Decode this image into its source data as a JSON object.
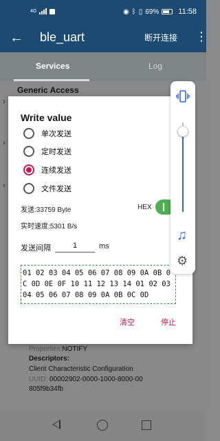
{
  "status_bar": {
    "network": "4G",
    "battery": "69%",
    "time": "11:58"
  },
  "app_bar": {
    "title": "ble_uart",
    "disconnect_label": "断开连接"
  },
  "tabs": [
    {
      "label": "Services",
      "active": true
    },
    {
      "label": "Log",
      "active": false
    }
  ],
  "background": {
    "service_title": "Generic Access",
    "properties_label": "Properties:",
    "properties_value": "NOTIFY",
    "descriptors_label": "Descriptors:",
    "descriptor_name": "Client Characteristic Configuration",
    "uuid_label": "UUID:",
    "uuid_value": "00002902-0000-1000-8000-00",
    "uuid_value_2": "805f9b34fb"
  },
  "dialog": {
    "title": "Write value",
    "options": [
      {
        "label": "单次发送",
        "checked": false
      },
      {
        "label": "定时发送",
        "checked": false
      },
      {
        "label": "连续发送",
        "checked": true
      },
      {
        "label": "文件发送",
        "checked": false
      }
    ],
    "sent_text": "发送:33759 Byte",
    "hex_label": "HEX",
    "hex_enabled": true,
    "speed_text": "实时速度:5301 B/s",
    "interval_label": "发送间隔",
    "interval_value": "1",
    "interval_unit": "ms",
    "data": "01 02 03 04 05 06 07 08 09 0A 0B 0C 0D 0E 0F 10 11 12 13 14 01 02 03 04 05 06 07 08 09 0A 0B 0C 0D",
    "clear_label": "清空",
    "stop_label": "停止"
  },
  "floating_panel": {
    "volume_level": 0.92,
    "icons": [
      "vibrate-icon",
      "music-note-icon",
      "gear-icon"
    ]
  },
  "colors": {
    "app_bar": "#1d4a73",
    "accent": "#c2185b",
    "toggle_on": "#4caf50",
    "slider": "#2962ff"
  }
}
